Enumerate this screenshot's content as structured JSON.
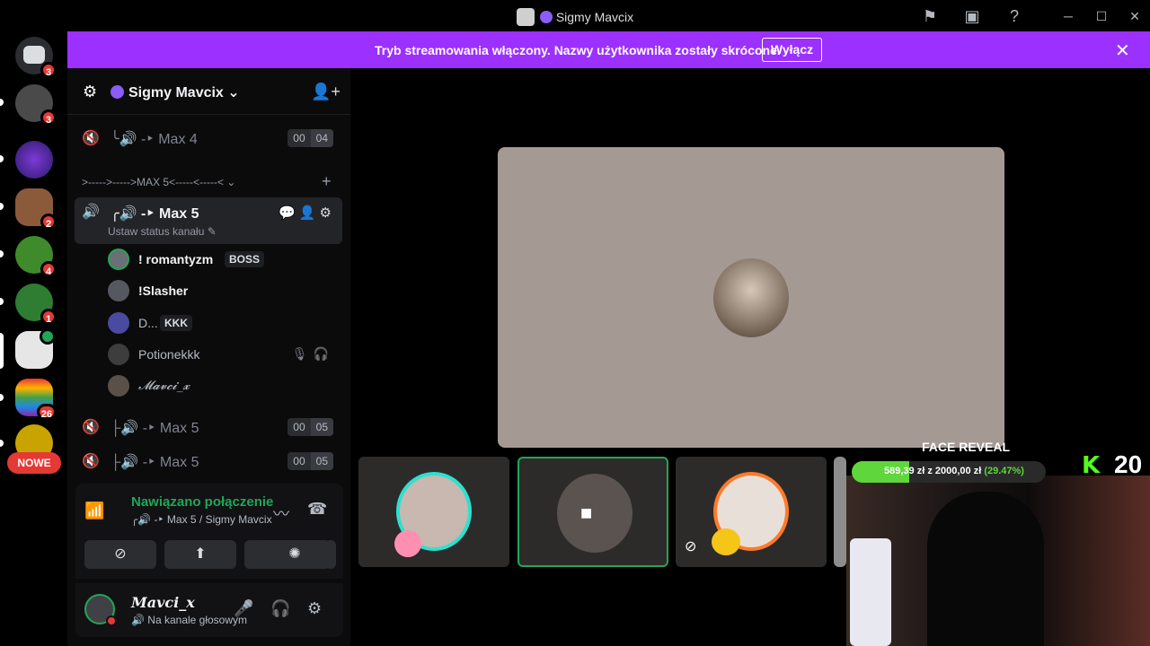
{
  "window": {
    "title": "Sigmy Mavcix",
    "controls": [
      "minimize",
      "maximize",
      "close"
    ]
  },
  "rail": {
    "servers": [
      {
        "name": "discord-home",
        "badge": "3"
      },
      {
        "name": "server-2",
        "badge": "3"
      },
      {
        "name": "zakon",
        "badge": ""
      },
      {
        "name": "server-4",
        "badge": "2"
      },
      {
        "name": "server-5",
        "badge": "4"
      },
      {
        "name": "server-6",
        "badge": "1"
      },
      {
        "name": "server-7",
        "badge": ""
      },
      {
        "name": "server-8",
        "badge": "26"
      },
      {
        "name": "server-9",
        "badge": ""
      }
    ],
    "new_label": "NOWE"
  },
  "banner": {
    "text": "Tryb streamowania włączony. Nazwy użytkownika zostały skrócone.",
    "button": "Wyłącz"
  },
  "server": {
    "name": "Sigmy Mavcix"
  },
  "channels": {
    "top": {
      "name": "╰🔊 -‣ Max 4",
      "count_a": "00",
      "count_b": "04"
    },
    "category": ">----->----->MAX 5<-----<-----<",
    "active": {
      "name": "╭🔊 -‣ Max 5",
      "status": "Ustaw status kanału"
    },
    "users": [
      {
        "name": "! romantyzm",
        "tag": "BOSS",
        "bold": true
      },
      {
        "name": "!Slasher",
        "tag": "",
        "bold": true
      },
      {
        "name": "D...",
        "tag": "KKK",
        "bold": false
      },
      {
        "name": "Potionekkk",
        "tag": "",
        "bold": false
      },
      {
        "name": "𝓜𝓪𝓿𝓬𝓲_𝔁",
        "tag": "",
        "bold": false
      }
    ],
    "other": [
      {
        "name": "├🔊 -‣ Max 5",
        "count_a": "00",
        "count_b": "05"
      },
      {
        "name": "├🔊 -‣ Max 5",
        "count_a": "00",
        "count_b": "05"
      }
    ]
  },
  "voice": {
    "status": "Nawiązano połączenie",
    "channel": "╭🔊 -‣ Max 5 / Sigmy Mavcix"
  },
  "user": {
    "name": "Mavci_x",
    "status": "Na kanale głosowym"
  },
  "overlay": {
    "title": "FACE REVEAL",
    "raised": "589,39 zł",
    "goal": "2000,00 zł",
    "percent": "(29.47%)",
    "progress": 0.2947,
    "viewer_count": "20"
  },
  "colors": {
    "accent": "#9b30ff",
    "online": "#23a559",
    "badge": "#e53935"
  }
}
